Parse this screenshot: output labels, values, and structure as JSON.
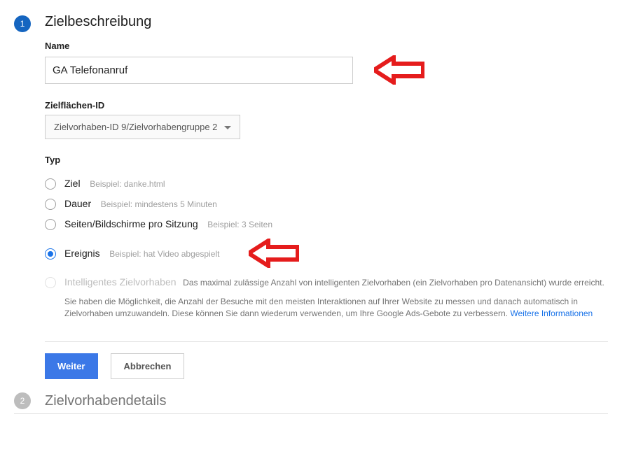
{
  "step1": {
    "number": "1",
    "title": "Zielbeschreibung",
    "name_label": "Name",
    "name_value": "GA Telefonanruf",
    "goal_id_label": "Zielflächen-ID",
    "goal_id_value": "Zielvorhaben-ID 9/Zielvorhabengruppe 2",
    "type_label": "Typ",
    "types": {
      "destination": {
        "label": "Ziel",
        "example": "Beispiel: danke.html"
      },
      "duration": {
        "label": "Dauer",
        "example": "Beispiel: mindestens 5 Minuten"
      },
      "pages": {
        "label": "Seiten/Bildschirme pro Sitzung",
        "example": "Beispiel: 3 Seiten"
      },
      "event": {
        "label": "Ereignis",
        "example": "Beispiel: hat Video abgespielt"
      },
      "smart": {
        "label": "Intelligentes Zielvorhaben",
        "desc": "Das maximal zulässige Anzahl von intelligenten Zielvorhaben (ein Zielvorhaben pro Datenansicht) wurde erreicht.",
        "note": "Sie haben die Möglichkeit, die Anzahl der Besuche mit den meisten Interaktionen auf Ihrer Website zu messen und danach automatisch in Zielvorhaben umzuwandeln. Diese können Sie dann wiederum verwenden, um Ihre Google Ads-Gebote zu verbessern.",
        "link": "Weitere Informationen"
      }
    },
    "continue_btn": "Weiter",
    "cancel_btn": "Abbrechen"
  },
  "step2": {
    "number": "2",
    "title": "Zielvorhabendetails"
  }
}
